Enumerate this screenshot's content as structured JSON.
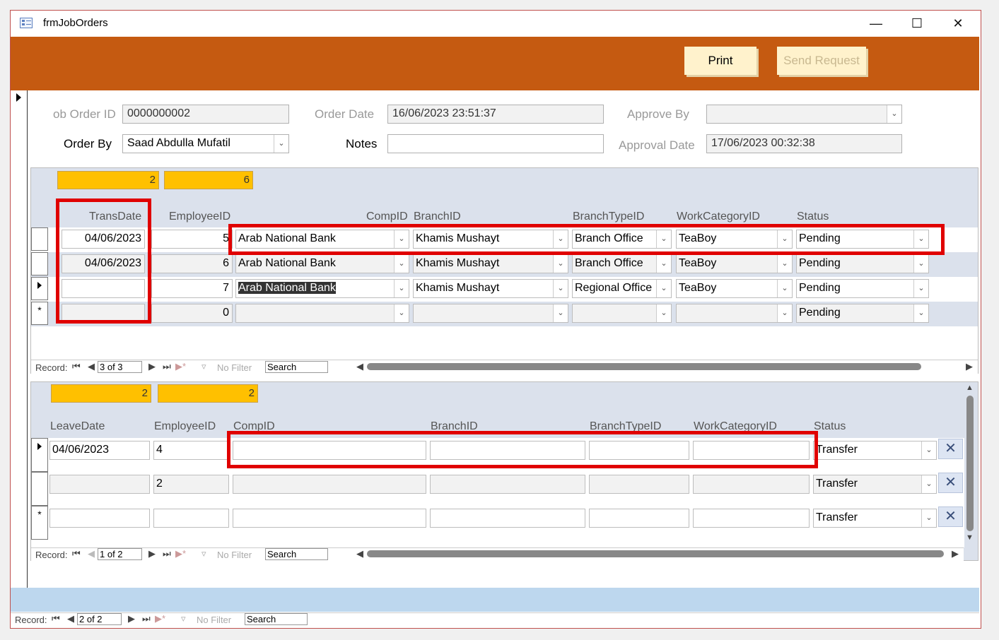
{
  "window": {
    "title": "frmJobOrders",
    "minimize_icon": "—",
    "maximize_icon": "☐",
    "close_icon": "✕"
  },
  "header": {
    "print_label": "Print",
    "send_label": "Send Request"
  },
  "form": {
    "job_order_id_label": "ob Order ID",
    "job_order_id_value": "0000000002",
    "order_date_label": "Order Date",
    "order_date_value": "16/06/2023 23:51:37",
    "approve_by_label": "Approve By",
    "approve_by_value": "",
    "order_by_label": "Order By",
    "order_by_value": "Saad Abdulla Mufatil",
    "notes_label": "Notes",
    "notes_value": "",
    "approval_date_label": "Approval Date",
    "approval_date_value": "17/06/2023 00:32:38"
  },
  "sub1": {
    "count_a": "2",
    "count_b": "6",
    "headers": [
      "TransDate",
      "EmployeeID",
      "CompID",
      "BranchID",
      "BranchTypeID",
      "WorkCategoryID",
      "Status"
    ],
    "rows": [
      {
        "date": "04/06/2023",
        "emp": "5",
        "comp": "Arab National Bank",
        "branch": "Khamis Mushayt",
        "btype": "Branch Office",
        "work": "TeaBoy",
        "status": "Pending"
      },
      {
        "date": "04/06/2023",
        "emp": "6",
        "comp": "Arab National Bank",
        "branch": "Khamis Mushayt",
        "btype": "Branch Office",
        "work": "TeaBoy",
        "status": "Pending"
      },
      {
        "date": "",
        "emp": "7",
        "comp": "Arab National Bank",
        "branch": "Khamis Mushayt",
        "btype": "Regional Office",
        "work": "TeaBoy",
        "status": "Pending"
      },
      {
        "date": "",
        "emp": "0",
        "comp": "",
        "branch": "",
        "btype": "",
        "work": "",
        "status": "Pending"
      }
    ],
    "nav": {
      "record_label": "Record:",
      "position": "3 of 3",
      "filter_label": "No Filter",
      "search_label": "Search"
    }
  },
  "sub2": {
    "count_a": "2",
    "count_b": "2",
    "headers": [
      "LeaveDate",
      "EmployeeID",
      "CompID",
      "BranchID",
      "BranchTypeID",
      "WorkCategoryID",
      "Status"
    ],
    "rows": [
      {
        "date": "04/06/2023",
        "emp": "4",
        "status": "Transfer"
      },
      {
        "date": "",
        "emp": "2",
        "status": "Transfer"
      },
      {
        "date": "",
        "emp": "",
        "status": "Transfer"
      }
    ],
    "nav": {
      "record_label": "Record:",
      "position": "1 of 2",
      "filter_label": "No Filter",
      "search_label": "Search"
    }
  },
  "mainnav": {
    "record_label": "Record:",
    "position": "2 of 2",
    "filter_label": "No Filter",
    "search_label": "Search"
  },
  "colors": {
    "accent": "#c55a11",
    "highlight": "#ffc000",
    "subform_bg": "#dbe1ec",
    "footer_band": "#bdd7ee",
    "annotation_red": "#e00000"
  }
}
